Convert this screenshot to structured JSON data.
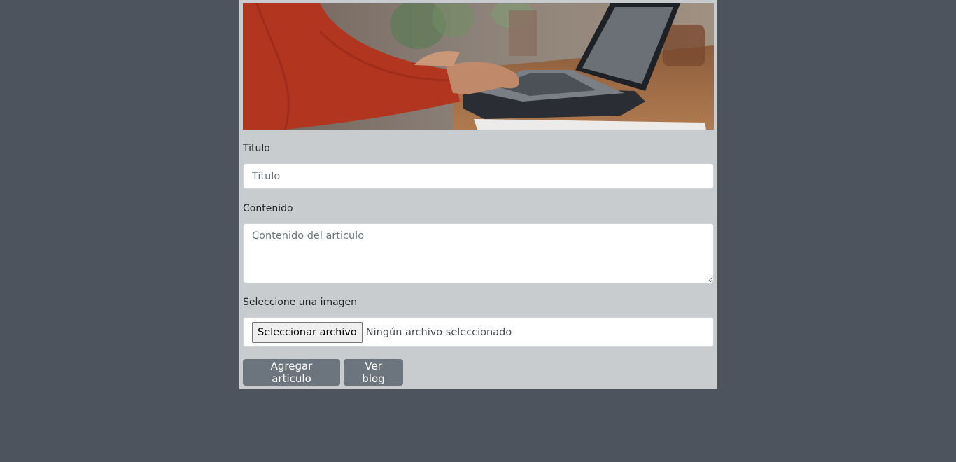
{
  "hero": {
    "image_icon": "laptop-typing-photo",
    "colors": {
      "sweater": "#b2351f",
      "laptop": "#23262b",
      "desk": "#9a6a45",
      "background": "#7e756d"
    }
  },
  "form": {
    "title_label": "Titulo",
    "title_placeholder": "Titulo",
    "content_label": "Contenido",
    "content_placeholder": "Contenido del articulo",
    "image_label": "Seleccione una imagen",
    "file_button": "Seleccionar archivo",
    "file_status": "Ningún archivo seleccionado"
  },
  "actions": {
    "add_label": "Agregar articulo",
    "blog_label": "Ver blog"
  },
  "colors": {
    "page_background": "#4e545e",
    "panel_background": "#c9cccf",
    "button_background": "#6c757d"
  }
}
